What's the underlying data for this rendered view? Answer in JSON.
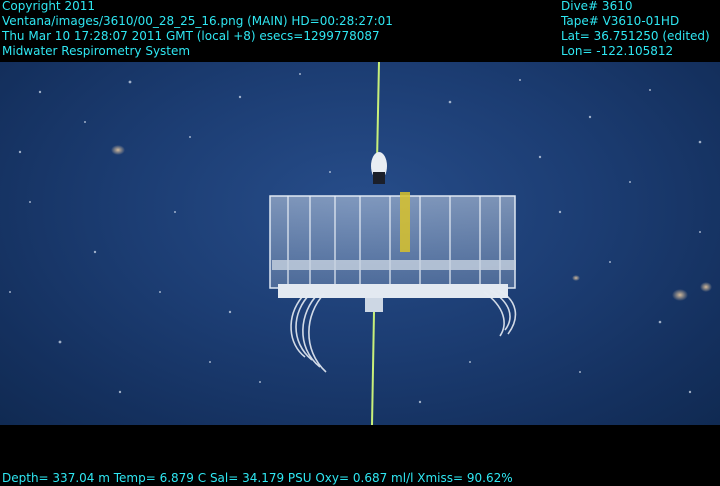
{
  "overlay": {
    "left_lines": [
      "Copyright 2011",
      "Ventana/images/3610/00_28_25_16.png (MAIN)  HD=00:28:27:01",
      "Thu Mar 10 17:28:07 2011 GMT (local +8)  esecs=1299778087",
      "Midwater Respirometry System"
    ],
    "right_lines": [
      "Dive# 3610",
      "Tape# V3610-01HD",
      "Lat= 36.751250 (edited)",
      "Lon= -122.105812"
    ],
    "bottom_line": "Depth= 337.04 m  Temp= 6.879 C  Sal= 34.179 PSU  Oxy= 0.687 ml/l  Xmiss= 90.62%"
  },
  "colors": {
    "overlay_text": "#2fe7f2",
    "water": "#1c3d73",
    "cable": "#c8f07a"
  }
}
